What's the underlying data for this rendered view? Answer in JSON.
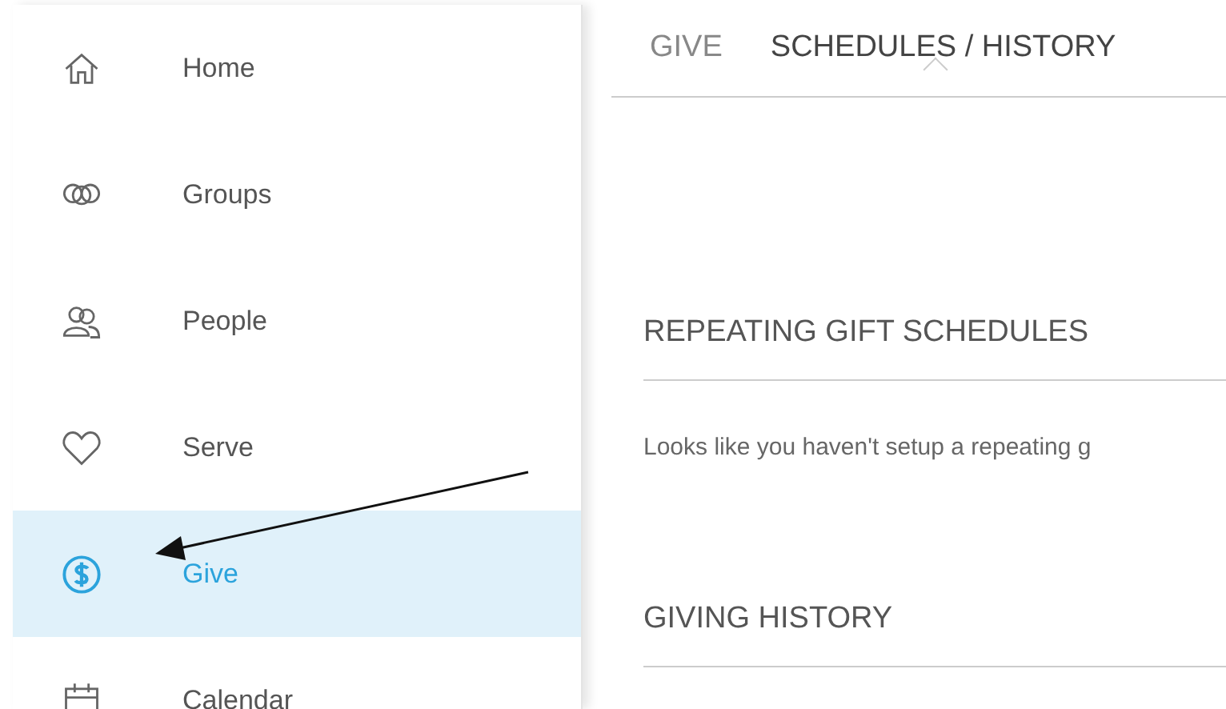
{
  "sidebar": {
    "items": [
      {
        "label": "Home",
        "kind": "home",
        "selected": false
      },
      {
        "label": "Groups",
        "kind": "groups",
        "selected": false
      },
      {
        "label": "People",
        "kind": "people",
        "selected": false
      },
      {
        "label": "Serve",
        "kind": "serve",
        "selected": false
      },
      {
        "label": "Give",
        "kind": "give",
        "selected": true
      },
      {
        "label": "Calendar",
        "kind": "calendar",
        "selected": false
      }
    ]
  },
  "tabs": [
    {
      "label": "GIVE",
      "selected": false
    },
    {
      "label": "SCHEDULES / HISTORY",
      "selected": true
    }
  ],
  "sections": [
    {
      "heading": "REPEATING GIFT SCHEDULES",
      "message": "Looks like you haven't setup a repeating g"
    },
    {
      "heading": "GIVING HISTORY"
    }
  ]
}
